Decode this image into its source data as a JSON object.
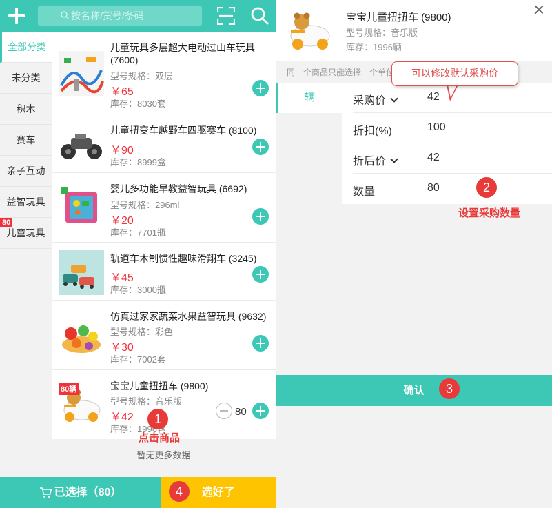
{
  "search": {
    "placeholder": "按名称/货号/条码"
  },
  "categories": [
    {
      "label": "全部分类",
      "active": true
    },
    {
      "label": "未分类"
    },
    {
      "label": "积木"
    },
    {
      "label": "赛车"
    },
    {
      "label": "亲子互动"
    },
    {
      "label": "益智玩具"
    },
    {
      "label": "儿童玩具",
      "badge": "80"
    }
  ],
  "products": [
    {
      "name": "儿童玩具多层超大电动过山车玩具 (7600)",
      "spec": "型号规格：双层",
      "price": "￥65",
      "stock": "库存：8030套"
    },
    {
      "name": "儿童扭变车越野车四驱赛车 (8100)",
      "price": "￥90",
      "stock": "库存：8999盒"
    },
    {
      "name": "婴儿多功能早教益智玩具 (6692)",
      "spec": "型号规格：296ml",
      "price": "￥20",
      "stock": "库存：7701瓶"
    },
    {
      "name": "轨道车木制惯性趣味滑翔车 (3245)",
      "price": "￥45",
      "stock": "库存：3000瓶"
    },
    {
      "name": "仿真过家家蔬菜水果益智玩具 (9632)",
      "spec": "型号规格：彩色",
      "price": "￥30",
      "stock": "库存：7002套"
    },
    {
      "name": "宝宝儿童扭扭车 (9800)",
      "spec": "型号规格：音乐版",
      "price": "￥42",
      "stock": "库存：1996辆",
      "badge": "80辆",
      "qty": "80"
    }
  ],
  "list_footer": "暂无更多数据",
  "bottom": {
    "selected_label": "已选择（80）",
    "done_label": "选好了"
  },
  "detail": {
    "name": "宝宝儿童扭扭车 (9800)",
    "spec": "型号规格：音乐版",
    "stock": "库存：1996辆",
    "notice": "同一个商品只能选择一个单位",
    "unit": "辆",
    "fields": [
      {
        "label": "采购价",
        "value": "42",
        "dropdown": true
      },
      {
        "label": "折扣(%)",
        "value": "100"
      },
      {
        "label": "折后价",
        "value": "42",
        "dropdown": true
      },
      {
        "label": "数量",
        "value": "80"
      }
    ],
    "confirm_label": "确认"
  },
  "annotations": {
    "tip_price": "可以修改默认采购价",
    "step1_num": "1",
    "step1_text": "点击商品",
    "step2_num": "2",
    "step2_text": "设置采购数量",
    "step3_num": "3",
    "step4_num": "4"
  },
  "colors": {
    "accent": "#3cc8b4",
    "price": "#f0323c",
    "done": "#ffc400",
    "annotation": "#e93a3a"
  }
}
